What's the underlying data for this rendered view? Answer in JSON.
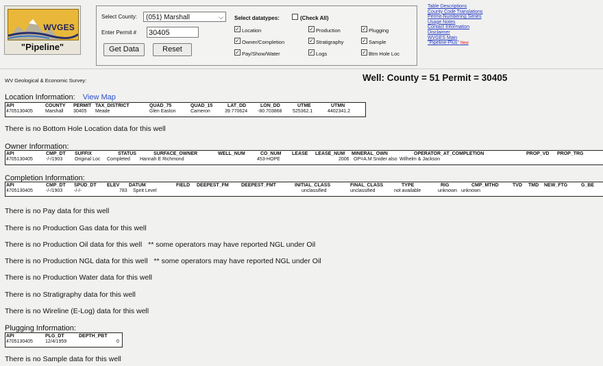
{
  "logo": {
    "word": "WVGES",
    "subtitle": "\"Pipeline\""
  },
  "form": {
    "county_label": "Select County:",
    "county_value": "(051) Marshall",
    "permit_label": "Enter Permit #",
    "permit_value": "30405",
    "get_button": "Get Data",
    "reset_button": "Reset",
    "datatypes_label": "Select datatypes:",
    "check_all": "(Check All)",
    "checkboxes": [
      {
        "label": "Location",
        "checked": true
      },
      {
        "label": "Owner/Completion",
        "checked": true
      },
      {
        "label": "Pay/Show/Water",
        "checked": true
      },
      {
        "label": "Production",
        "checked": true
      },
      {
        "label": "Stratigraphy",
        "checked": true
      },
      {
        "label": "Logs",
        "checked": true
      },
      {
        "label": "Plugging",
        "checked": true
      },
      {
        "label": "Sample",
        "checked": true
      },
      {
        "label": "Btm Hole Loc",
        "checked": true
      }
    ]
  },
  "links": [
    "Table Descriptions",
    "County Code Translations",
    "Permit-Numbering Series",
    "Usage Notes",
    "Contact Information",
    "Disclaimer",
    "WVGES Main",
    "\"Pipeline-Plus\""
  ],
  "new_badge": "New",
  "survey": "WV Geological & Economic Survey:",
  "well_title": "Well:  County = 51 Permit = 30405",
  "location": {
    "title": "Location Information:",
    "map_link": "View Map",
    "headers": [
      "API",
      "COUNTY",
      "PERMIT",
      "TAX_DISTRICT",
      "QUAD_75",
      "QUAD_15",
      "LAT_DD",
      "LON_DD",
      "UTME",
      "UTMN"
    ],
    "values": [
      "4705130405",
      "Marshall",
      "30405",
      "Meade",
      "",
      "Glen Easton",
      "Cameron",
      "39.770624",
      "-80.703868",
      "525362.1",
      "4402341.2"
    ]
  },
  "bottom_hole": "There is no Bottom Hole Location data for this well",
  "owner": {
    "title": "Owner Information:",
    "headers": [
      "API",
      "CMP_DT",
      "SUFFIX",
      "STATUS",
      "SURFACE_OWNER",
      "WELL_NUM",
      "CO_NUM",
      "LEASE",
      "LEASE_NUM",
      "MINERAL_OWN",
      "OPERATOR_AT_COMPLETION",
      "PROP_VD",
      "PROP_TRG"
    ],
    "values": [
      "4705130405",
      "-/-/1903",
      "Original Loc",
      "Completed",
      "Hannah E Richmond",
      "",
      "453-HOPE",
      "",
      "2006",
      "OP=A.M Snider also",
      "Wilhelm & Jackson"
    ]
  },
  "completion": {
    "title": "Completion Information:",
    "headers": [
      "API",
      "CMP_DT",
      "SPUD_DT",
      "ELEV",
      "DATUM",
      "FIELD",
      "DEEPEST_FM",
      "DEEPEST_FMT",
      "INITIAL_CLASS",
      "FINAL_CLASS",
      "TYPE",
      "RIG",
      "CMP_MTHD",
      "TVD",
      "TMD",
      "NEW_FTG",
      "G_BE"
    ],
    "values": [
      "4705130405",
      "-/-/1903",
      "-/-/-",
      "783",
      "Spirit Level",
      "",
      "",
      "",
      "unclassified",
      "unclassified",
      "not available",
      "unknown",
      "unknown"
    ]
  },
  "messages": {
    "pay": "There is no Pay data for this well",
    "gas": "There is no Production Gas data for this well",
    "oil": "There is no Production Oil data for this well",
    "oil_note": "** some operators may have reported NGL under Oil",
    "ngl": "There is no Production NGL data for this well",
    "ngl_note": "** some operators may have reported NGL under Oil",
    "water": "There is no Production Water data for this well",
    "strat": "There is no Stratigraphy data for this well",
    "wireline": "There is no Wireline (E-Log) data for this well",
    "sample": "There is no Sample data for this well"
  },
  "plugging": {
    "title": "Plugging Information:",
    "headers": [
      "API",
      "PLG_DT",
      "DEPTH_PBT"
    ],
    "values": [
      "4705130405",
      "12/4/1959",
      "0"
    ]
  }
}
